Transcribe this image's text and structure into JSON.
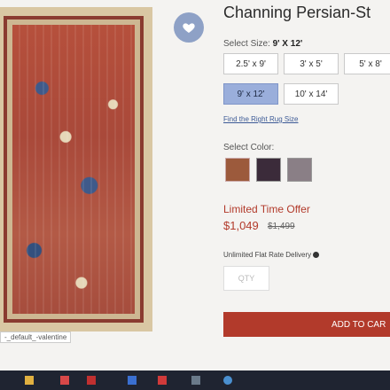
{
  "product": {
    "title": "Channing Persian-St",
    "image_caption": "-_default_-valentine"
  },
  "size": {
    "label_prefix": "Select Size:",
    "selected": "9' X 12'",
    "options": [
      "2.5' x 9'",
      "3' x 5'",
      "5' x 8'",
      "9' x 12'",
      "10' x 14'"
    ],
    "guide_link": "Find the Right Rug Size"
  },
  "color": {
    "label": "Select Color:",
    "swatches": [
      {
        "name": "rust-swatch",
        "color": "#9c5a3c"
      },
      {
        "name": "navy-swatch",
        "color": "#3b2b3a"
      },
      {
        "name": "gray-swatch",
        "color": "#8a7f86"
      }
    ]
  },
  "pricing": {
    "offer_label": "Limited Time Offer",
    "price": "$1,049",
    "original_price": "$1,499"
  },
  "delivery": {
    "text": "Unlimited Flat Rate Delivery"
  },
  "quantity": {
    "placeholder": "QTY"
  },
  "cart": {
    "button_label": "ADD TO CAR"
  },
  "colors": {
    "accent": "#b23a2b",
    "selected": "#9aaedb"
  },
  "taskbar": {
    "icons": [
      "folder-icon",
      "mail-icon",
      "media-icon",
      "app-icon",
      "gmail-icon",
      "settings-icon",
      "browser-icon"
    ]
  }
}
